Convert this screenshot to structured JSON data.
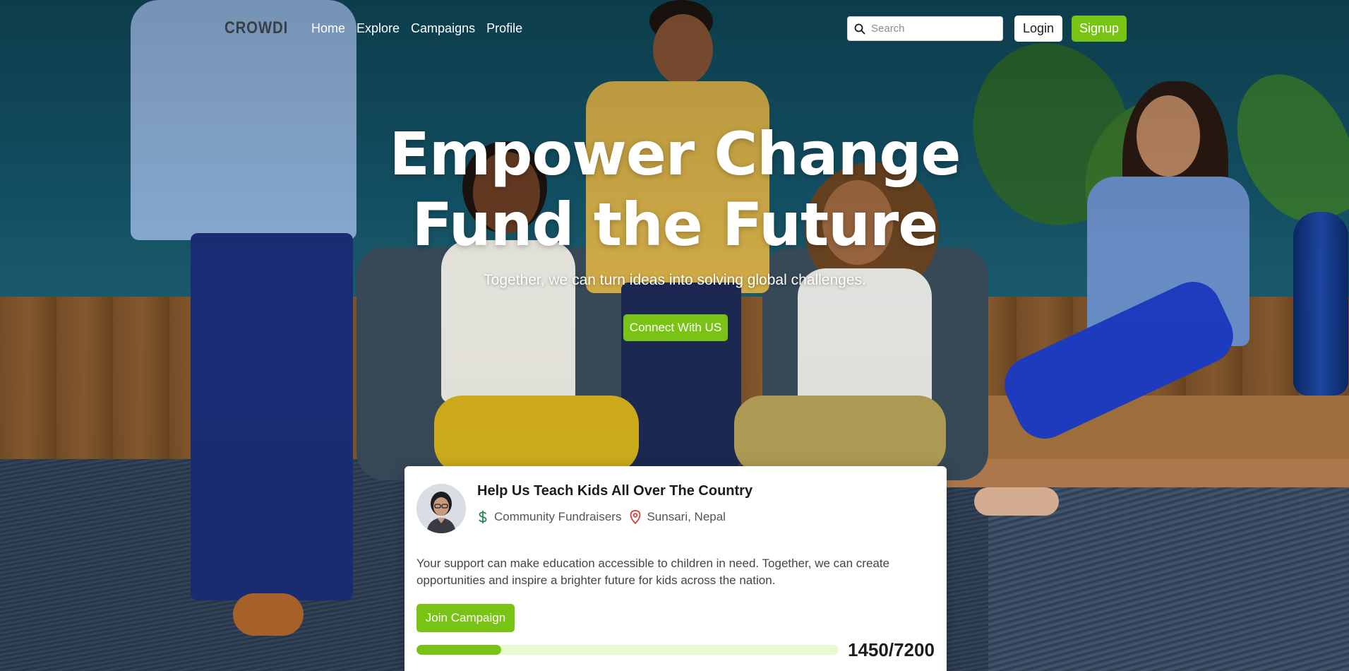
{
  "nav": {
    "logo": "CROWDI",
    "links": [
      "Home",
      "Explore",
      "Campaigns",
      "Profile"
    ],
    "search_placeholder": "Search",
    "login_label": "Login",
    "signup_label": "Signup"
  },
  "hero": {
    "title_line1": "Empower Change",
    "title_line2": "Fund the Future",
    "subtitle": "Together, we can turn ideas into solving global challenges.",
    "cta_label": "Connect With US"
  },
  "campaign": {
    "title": "Help Us Teach Kids All Over The Country",
    "category": "Community Fundraisers",
    "location": "Sunsari, Nepal",
    "description": "Your support can make education accessible to children in need. Together, we can create opportunities and inspire a brighter future for kids across the nation.",
    "join_label": "Join Campaign",
    "raised": 1450,
    "goal": 7200,
    "progress_text": "1450/7200"
  },
  "colors": {
    "accent": "#79c314",
    "progress_track": "#e9f9d0",
    "location_icon": "#d23a3a",
    "category_icon": "#1f8a55"
  },
  "icons": {
    "search": "search-icon",
    "category": "dollar-icon",
    "location": "map-pin-icon"
  }
}
